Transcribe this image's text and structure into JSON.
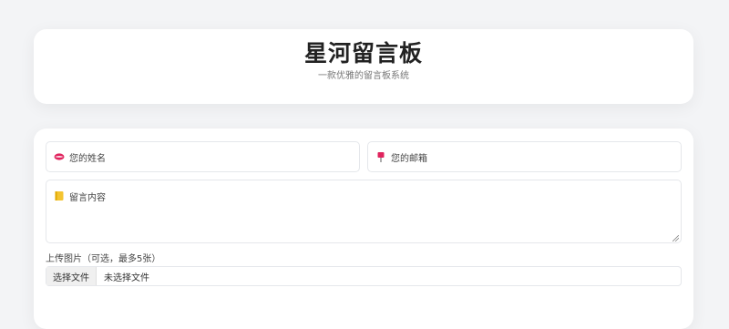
{
  "header": {
    "title": "星河留言板",
    "subtitle": "一款优雅的留言板系统"
  },
  "form": {
    "name_placeholder": "您的姓名",
    "name_icon": "lips-icon",
    "email_placeholder": "您的邮箱",
    "email_icon": "mailbox-icon",
    "message_placeholder": "留言内容",
    "message_icon": "note-icon",
    "upload_label": "上传图片（可选，最多5张）",
    "file_button_label": "选择文件",
    "file_status": "未选择文件"
  },
  "colors": {
    "background": "#f3f4f6",
    "card": "#ffffff",
    "border": "#e5e7eb",
    "accent_red": "#e0245e",
    "accent_yellow": "#f4c430"
  }
}
